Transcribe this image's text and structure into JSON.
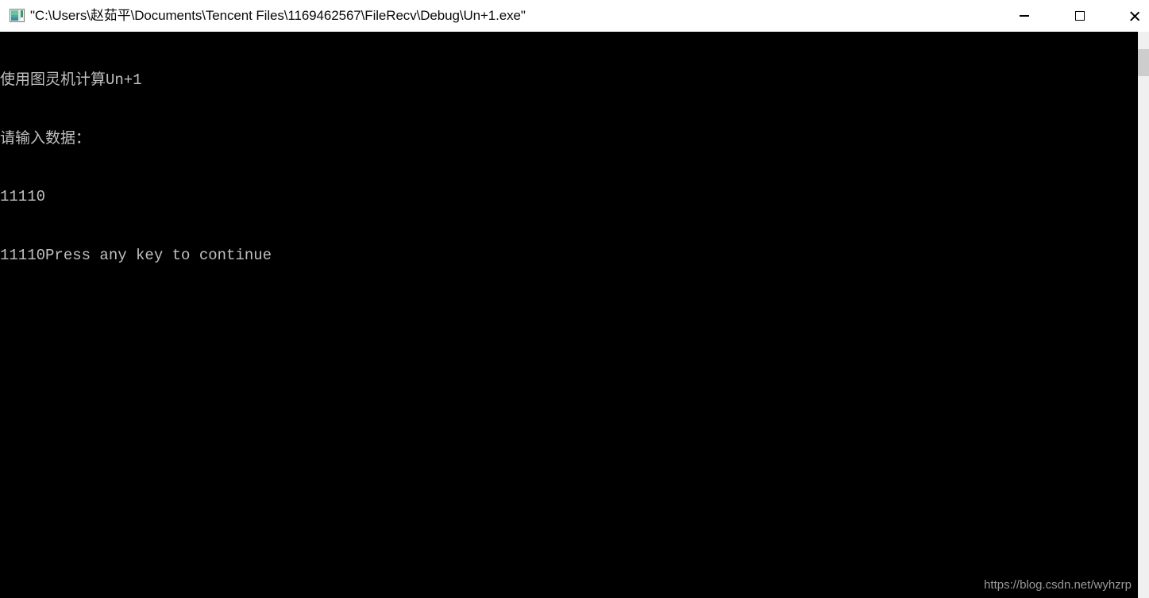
{
  "window": {
    "title": "\"C:\\Users\\赵茹平\\Documents\\Tencent Files\\1169462567\\FileRecv\\Debug\\Un+1.exe\"",
    "icon_name": "console-app-icon",
    "titlebar_background": "#ffffff",
    "titlebar_text_color": "#0b0b0b",
    "controls": {
      "minimize_label": "Minimize",
      "maximize_label": "Maximize",
      "close_label": "Close"
    }
  },
  "console": {
    "background": "#000000",
    "text_color": "#c0c0c0",
    "lines": [
      "使用图灵机计算Un+1",
      "请输入数据：",
      "11110",
      "11110Press any key to continue"
    ]
  },
  "scrollbar": {
    "track_color": "#f0f0f0",
    "thumb_color": "#cdcdcd",
    "orientation": "vertical"
  },
  "watermark": {
    "text": "https://blog.csdn.net/wyhzrp",
    "color": "#9a9a9a"
  }
}
